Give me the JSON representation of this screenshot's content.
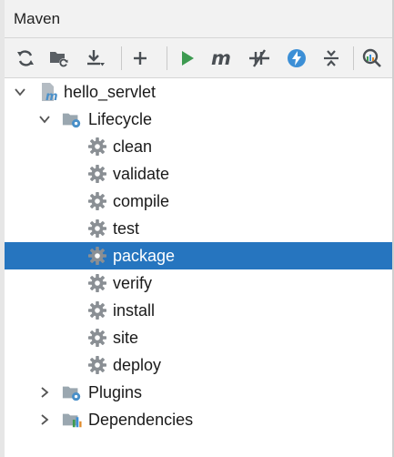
{
  "panel": {
    "title": "Maven"
  },
  "toolbar": {
    "buttons": [
      {
        "name": "reload-all-projects",
        "icon": "refresh-icon"
      },
      {
        "name": "generate-sources",
        "icon": "folder-refresh-icon"
      },
      {
        "name": "download-sources",
        "icon": "download-icon"
      },
      {
        "name": "add-maven-project",
        "icon": "plus-icon"
      },
      {
        "name": "run-maven-build",
        "icon": "play-icon"
      },
      {
        "name": "execute-maven-goal",
        "icon": "maven-m-icon"
      },
      {
        "name": "toggle-offline-mode",
        "icon": "offline-icon"
      },
      {
        "name": "toggle-skip-tests",
        "icon": "lightning-icon"
      },
      {
        "name": "collapse-all",
        "icon": "collapse-icon"
      },
      {
        "name": "show-dependencies",
        "icon": "analyze-icon"
      }
    ]
  },
  "tree": {
    "project": "hello_servlet",
    "lifecycle": "Lifecycle",
    "goals": [
      "clean",
      "validate",
      "compile",
      "test",
      "package",
      "verify",
      "install",
      "site",
      "deploy"
    ],
    "selected_goal": "package",
    "plugins": "Plugins",
    "dependencies": "Dependencies"
  },
  "colors": {
    "selection": "#2675bf",
    "gear": "#8a8f94",
    "run_green": "#3d9a50",
    "skip_tests_blue": "#3c8fd6",
    "folder": "#9aa7b0",
    "maven_blue": "#4a90c9"
  }
}
